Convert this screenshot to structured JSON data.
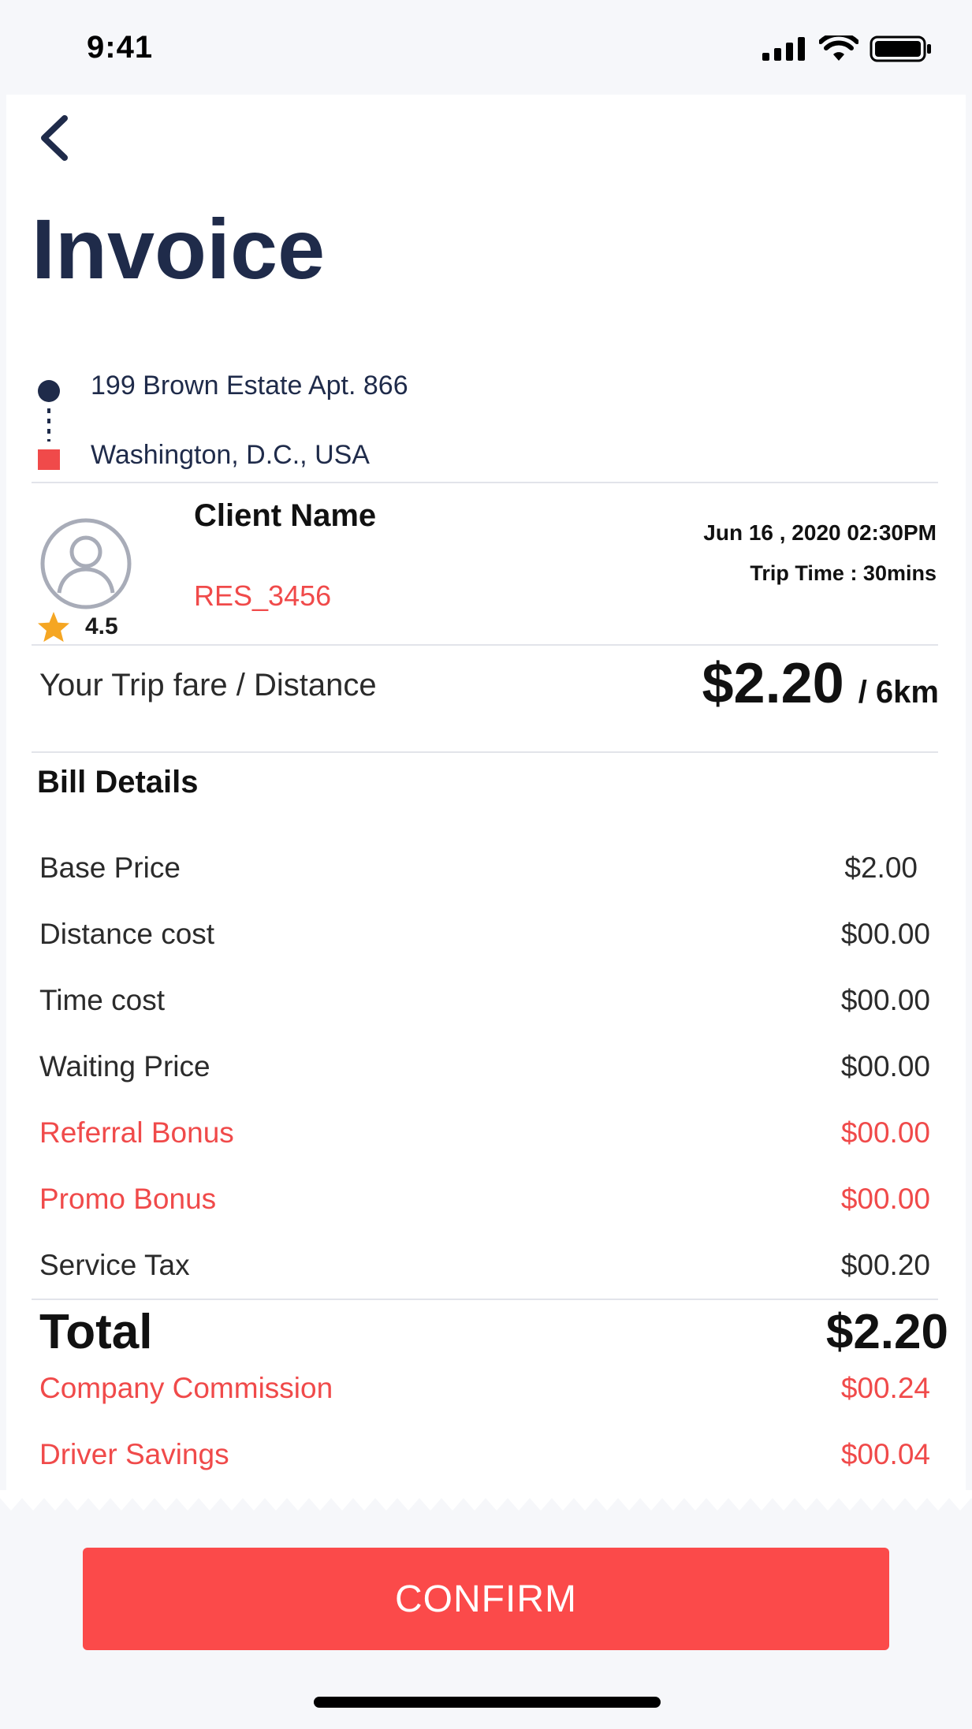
{
  "status_bar": {
    "time": "9:41"
  },
  "header": {
    "title": "Invoice"
  },
  "route": {
    "pickup": "199 Brown Estate Apt. 866",
    "dropoff": "Washington, D.C., USA"
  },
  "client": {
    "name": "Client Name",
    "id": "RES_3456",
    "rating": "4.5",
    "date": "Jun 16 , 2020  02:30PM",
    "trip_time": "Trip Time : 30mins"
  },
  "fare": {
    "label": "Your Trip fare / Distance",
    "amount": "$2.20",
    "distance": "/ 6km"
  },
  "bill": {
    "heading": "Bill Details",
    "items": [
      {
        "label": "Base Price",
        "value": "$2.00"
      },
      {
        "label": "Distance cost",
        "value": "$00.00"
      },
      {
        "label": "Time cost",
        "value": "$00.00"
      },
      {
        "label": "Waiting Price",
        "value": "$00.00"
      },
      {
        "label": "Referral Bonus",
        "value": "$00.00"
      },
      {
        "label": "Promo Bonus",
        "value": "$00.00"
      },
      {
        "label": "Service Tax",
        "value": "$00.20"
      }
    ],
    "total_label": "Total",
    "total_value": "$2.20",
    "extras": [
      {
        "label": "Company Commission",
        "value": "$00.24"
      },
      {
        "label": "Driver Savings",
        "value": "$00.04"
      }
    ]
  },
  "actions": {
    "confirm_label": "CONFIRM"
  },
  "colors": {
    "accent": "#fb4a4a",
    "navy": "#1f2b4a",
    "star": "#f5a623"
  }
}
